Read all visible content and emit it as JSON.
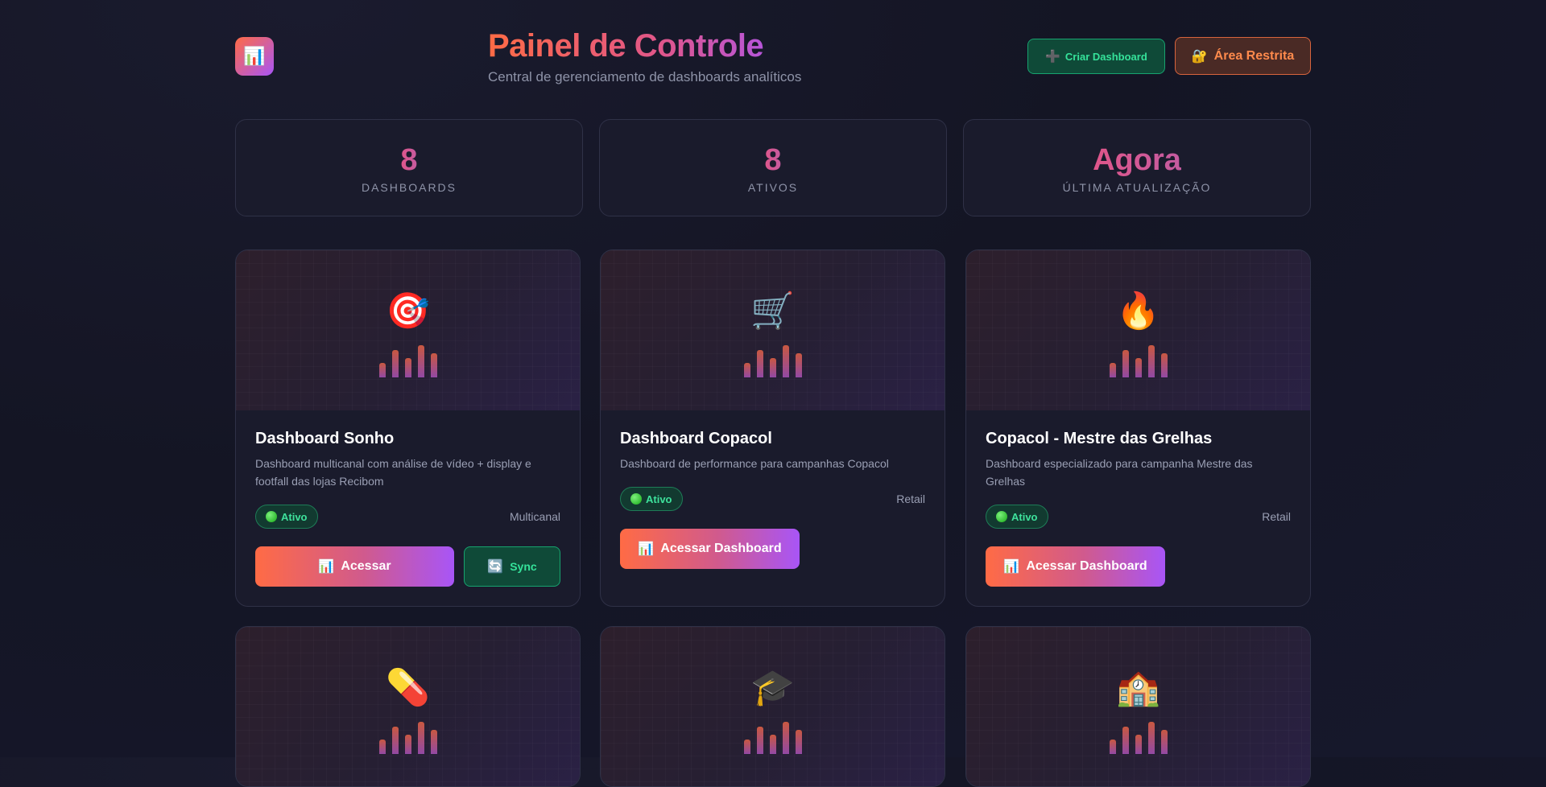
{
  "header": {
    "logo_icon": "📊",
    "title": "Painel de Controle",
    "subtitle": "Central de gerenciamento de dashboards analíticos",
    "create_button": {
      "icon": "➕",
      "label": "Criar Dashboard"
    },
    "restricted_button": {
      "icon": "🔐",
      "label": "Área Restrita"
    }
  },
  "stats": [
    {
      "value": "8",
      "label": "Dashboards"
    },
    {
      "value": "8",
      "label": "Ativos"
    },
    {
      "value": "Agora",
      "label": "Última Atualização"
    }
  ],
  "cards": [
    {
      "icon": "🎯",
      "title": "Dashboard Sonho",
      "description": "Dashboard multicanal com análise de vídeo + display e footfall das lojas Recibom",
      "status": "Ativo",
      "category": "Multicanal",
      "primary_icon": "📊",
      "primary_label": "Acessar",
      "sync_icon": "🔄",
      "sync_label": "Sync"
    },
    {
      "icon": "🛒",
      "title": "Dashboard Copacol",
      "description": "Dashboard de performance para campanhas Copacol",
      "status": "Ativo",
      "category": "Retail",
      "primary_icon": "📊",
      "primary_label": "Acessar Dashboard"
    },
    {
      "icon": "🔥",
      "title": "Copacol - Mestre das Grelhas",
      "description": "Dashboard especializado para campanha Mestre das Grelhas",
      "status": "Ativo",
      "category": "Retail",
      "primary_icon": "📊",
      "primary_label": "Acessar Dashboard"
    },
    {
      "icon": "💊"
    },
    {
      "icon": "🎓"
    },
    {
      "icon": "🏫"
    }
  ],
  "colors": {
    "accent_start": "#ff6b45",
    "accent_end": "#a855f7",
    "success": "#35e29a",
    "warning": "#ff8a4c",
    "background": "#141524",
    "card": "#1a1b2c"
  }
}
